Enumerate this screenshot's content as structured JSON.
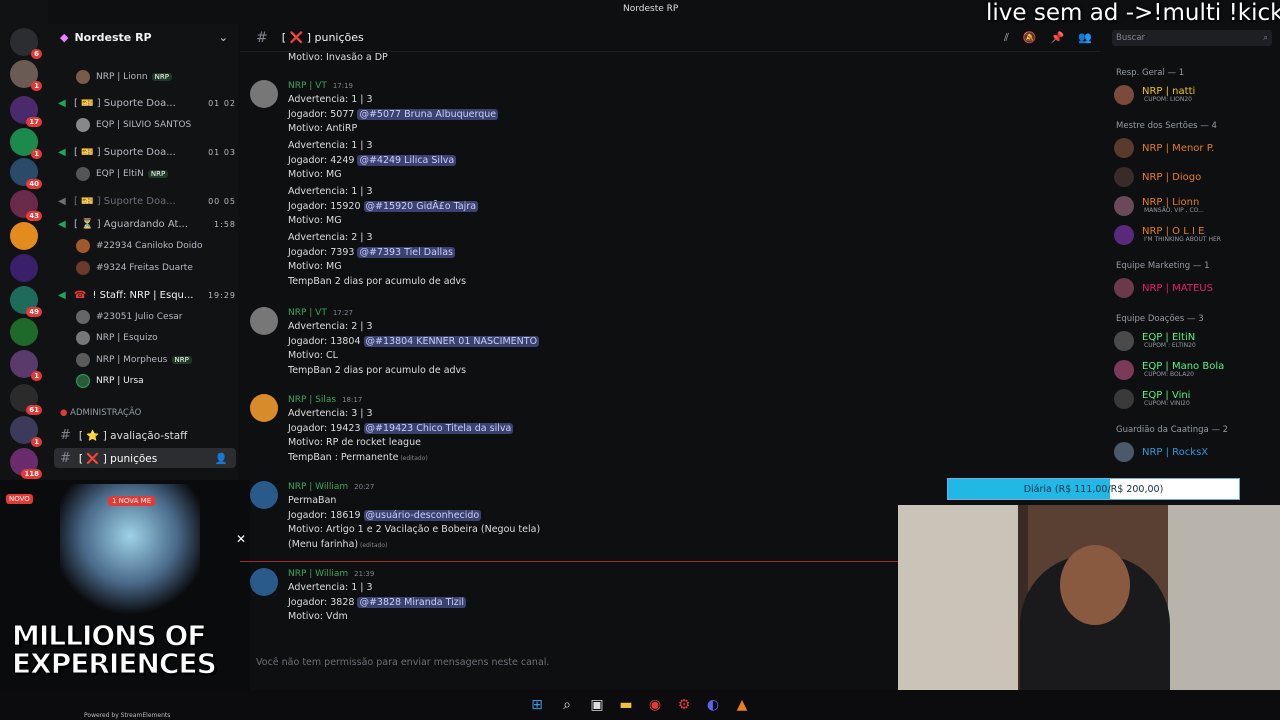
{
  "window": {
    "title": "Nordeste RP"
  },
  "server": {
    "name": "Nordeste RP"
  },
  "rail_badges": [
    "6",
    "1",
    "17",
    "1",
    "40",
    "43",
    "49",
    "1",
    "61",
    "1",
    "118"
  ],
  "sidebar": {
    "voice": [
      {
        "label": "[ 🎫 ] Suporte Doa...",
        "count": "01  02",
        "user": "EQP | SILVIO SANTOS"
      },
      {
        "label": "[ 🎫 ] Suporte Doa...",
        "count": "01  03",
        "user": "EQP | EltiN",
        "tag": "NRP"
      },
      {
        "label": "[ 🎫 ] Suporte Doa...",
        "count": "00  05"
      },
      {
        "label": "[ ⏳ ] Aguardando At...",
        "count": "1:58",
        "users": [
          "#22934 Caniloko Doido",
          "#9324 Freitas Duarte"
        ]
      },
      {
        "label": "! Staff: NRP | Esqu...",
        "count": "19:29",
        "users": [
          "#23051 Julio Cesar",
          "NRP | Esquizo",
          "NRP | Morpheus",
          "NRP | Ursa"
        ]
      }
    ],
    "top_user": "NRP | Lionn",
    "top_user_tag": "NRP",
    "morpheus_tag": "NRP",
    "category": "ADMINISTRAÇÃO",
    "channels": [
      {
        "label": "[ ⭐ ] avaliação-staff"
      },
      {
        "label": "[ ❌ ] punições"
      }
    ]
  },
  "ad": {
    "title": "MILLIONS OF EXPERIENCES",
    "badge": "NOVO",
    "tag": "1 NOVA ME"
  },
  "chat": {
    "channel": "[ ❌ ] punições",
    "composer_placeholder": "Você não tem permissão para enviar mensagens neste canal.",
    "first_line": "Motivo: Invasão a DP",
    "messages": [
      {
        "author": "NRP | VT",
        "time": "17:19",
        "lines": [
          [
            "Advertencia: 1 | 3"
          ],
          [
            "Jogador: 5077 ",
            "@#5077 Bruna  Albuquerque"
          ],
          [
            "Motivo: AntiRP"
          ],
          [
            "Advertencia: 1 | 3"
          ],
          [
            "Jogador: 4249 ",
            "@#4249 Lilica Silva"
          ],
          [
            "Motivo: MG"
          ],
          [
            "Advertencia: 1 | 3"
          ],
          [
            "Jogador: 15920 ",
            "@#15920 GidÃ£o Tajra"
          ],
          [
            "Motivo: MG"
          ],
          [
            "Advertencia: 2 | 3"
          ],
          [
            "Jogador: 7393 ",
            "@#7393 Tiel  Dallas"
          ],
          [
            "Motivo: MG"
          ],
          [
            "TempBan 2 dias por acumulo de advs"
          ]
        ]
      },
      {
        "author": "NRP | VT",
        "time": "17:27",
        "lines": [
          [
            "Advertencia: 2 | 3"
          ],
          [
            "Jogador: 13804 ",
            "@#13804 KENNER 01 NASCIMENTO"
          ],
          [
            "Motivo: CL"
          ],
          [
            "TempBan 2 dias por acumulo de advs"
          ]
        ]
      },
      {
        "author": "NRP | Silas",
        "time": "18:17",
        "lines": [
          [
            "Advertencia: 3 | 3"
          ],
          [
            "Jogador: 19423 ",
            "@#19423 Chico Titela da silva"
          ],
          [
            "Motivo: RP de rocket league"
          ],
          [
            "TempBan : Permanente"
          ]
        ],
        "edited": "(editado)"
      },
      {
        "author": "NRP | William",
        "time": "20:27",
        "lines": [
          [
            "PermaBan"
          ],
          [
            "Jogador: 18619 ",
            "@usuário-desconhecido"
          ],
          [
            "Motivo: Artigo 1 e 2  Vacilação e Bobeira (Negou tela)"
          ],
          [
            "(Menu farinha)"
          ]
        ],
        "edited": "(editado)"
      },
      {
        "author": "NRP | William",
        "time": "21:39",
        "lines": [
          [
            "Advertencia: 1 | 3"
          ],
          [
            "Jogador: 3828 ",
            "@#3828 Miranda Tizil"
          ],
          [
            "Motivo: Vdm"
          ]
        ]
      }
    ]
  },
  "search": {
    "placeholder": "Buscar"
  },
  "members": {
    "groups": [
      {
        "title": "Resp. Geral — 1",
        "members": [
          {
            "name": "NRP | natti",
            "sub": "CUPOM: LION20",
            "color": "#f1c40f"
          }
        ]
      },
      {
        "title": "Mestre dos Sertões — 4",
        "members": [
          {
            "name": "NRP | Menor P.",
            "color": "#e67e22"
          },
          {
            "name": "NRP | Diogo",
            "color": "#e67e22"
          },
          {
            "name": "NRP | Lionn",
            "sub": "MANSÃO, VIP , CO...",
            "color": "#e67e22"
          },
          {
            "name": "NRP | O L I E",
            "sub": "I'M THINKING ABOUT HER",
            "color": "#e67e22"
          }
        ]
      },
      {
        "title": "Equipe Marketing — 1",
        "members": [
          {
            "name": "NRP | MATEUS",
            "color": "#e91e63"
          }
        ]
      },
      {
        "title": "Equipe Doações — 3",
        "members": [
          {
            "name": "EQP | EltiN",
            "sub": "CUPOM : ELTIN20",
            "color": "#57f287"
          },
          {
            "name": "EQP | Mano Bola",
            "sub": "CUPOM: BOLA20",
            "color": "#57f287"
          },
          {
            "name": "EQP | Vini",
            "sub": "CUPOM: VINI20",
            "color": "#57f287"
          }
        ]
      },
      {
        "title": "Guardião da Caatinga — 2",
        "members": [
          {
            "name": "NRP | RocksX",
            "color": "#3498db"
          }
        ]
      }
    ]
  },
  "stream": {
    "banner": "live sem ad ->!multi !kick",
    "goal": "Diária (R$ 111,00/R$ 200,00)",
    "goal_progress": 0.555,
    "powered_by": "Powered by StreamElements"
  },
  "colors": {
    "accent": "#5865f2",
    "online": "#23a55a",
    "vt_color": "#3ba55c"
  }
}
